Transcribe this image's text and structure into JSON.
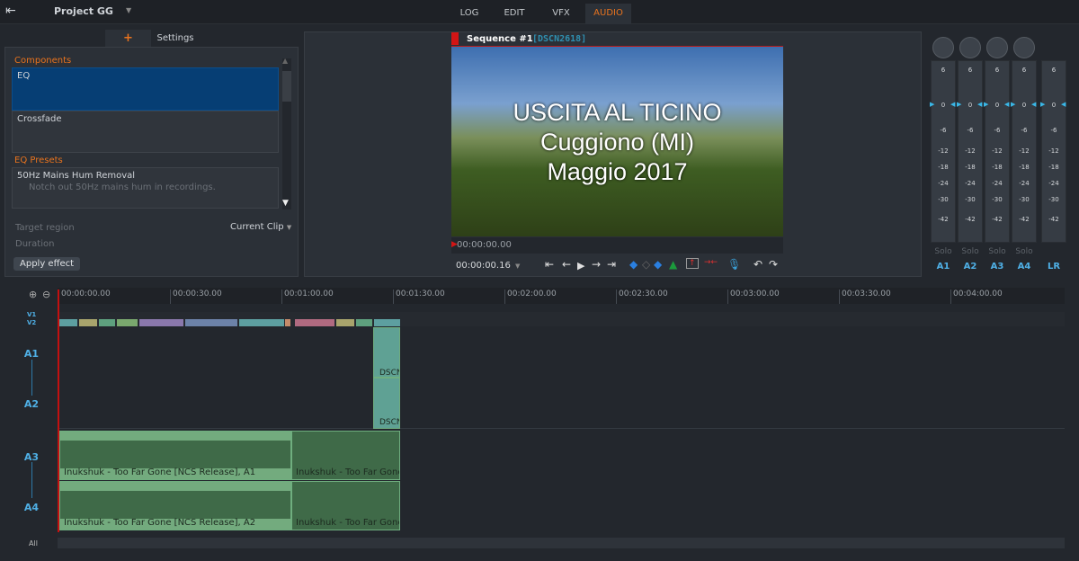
{
  "topbar": {
    "project": "Project GG",
    "tabs": [
      "LOG",
      "EDIT",
      "VFX",
      "AUDIO"
    ],
    "active_tab": "AUDIO",
    "accent": "#e8731e"
  },
  "left": {
    "tab_add": "+",
    "tab_settings": "Settings",
    "components_heading": "Components",
    "components": [
      "EQ",
      "Crossfade"
    ],
    "selected": "EQ",
    "presets_heading": "EQ Presets",
    "preset": {
      "name": "50Hz Mains Hum Removal",
      "desc": "Notch out 50Hz mains hum in recordings."
    },
    "target_region_label": "Target region",
    "target_region_value": "Current Clip",
    "duration_label": "Duration",
    "apply": "Apply effect"
  },
  "viewer": {
    "sequence": "Sequence #1",
    "clip": "[DSCN2618]",
    "overlay": [
      "USCITA AL TICINO",
      "Cuggiono (MI)",
      "Maggio 2017"
    ],
    "scrub_time": "00:00:00.00",
    "time": "00:00:00.16"
  },
  "mixer": {
    "scale": [
      "6",
      "0",
      "-6",
      "-12",
      "-18",
      "-24",
      "-30",
      "-42"
    ],
    "solo": "Solo",
    "channels": [
      "A1",
      "A2",
      "A3",
      "A4",
      "LR"
    ]
  },
  "timeline": {
    "ruler": [
      "00:00:00.00",
      "00:00:30.00",
      "00:01:00.00",
      "00:01:30.00",
      "00:02:00.00",
      "00:02:30.00",
      "00:03:00.00",
      "00:03:30.00",
      "00:04:00.00"
    ],
    "tracks": {
      "v1": "V1",
      "v2": "V2",
      "a1": "A1",
      "a2": "A2",
      "a3": "A3",
      "a4": "A4",
      "all": "All"
    },
    "video_clip_label": "DSCN",
    "audio_clips": {
      "a3_1": "Inukshuk - Too Far Gone [NCS Release], A1",
      "a3_2": "Inukshuk - Too Far Gone [",
      "a4_1": "Inukshuk - Too Far Gone [NCS Release], A2",
      "a4_2": "Inukshuk - Too Far Gone ["
    }
  }
}
